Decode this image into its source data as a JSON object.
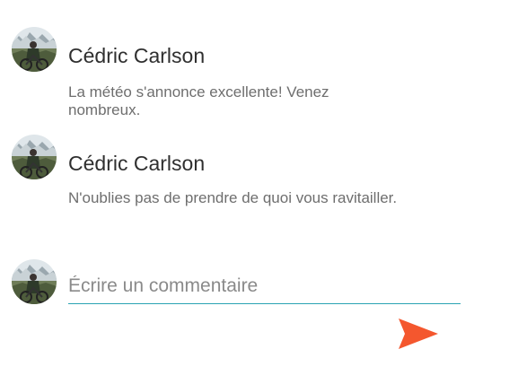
{
  "comments": [
    {
      "author": "Cédric Carlson",
      "text": "La météo s'annonce excellente! Venez nombreux."
    },
    {
      "author": "Cédric Carlson",
      "text": "N'oublies pas de prendre de quoi vous ravitailler."
    }
  ],
  "composer": {
    "value": "",
    "placeholder": "Écrire un commentaire"
  },
  "icons": {
    "avatar": "user-photo-avatar-icon",
    "send": "send-icon"
  },
  "colors": {
    "accent": "#f4572e",
    "underline": "#2aa3b3",
    "author": "#2f2f2f",
    "body_text": "#6e6e6e"
  }
}
